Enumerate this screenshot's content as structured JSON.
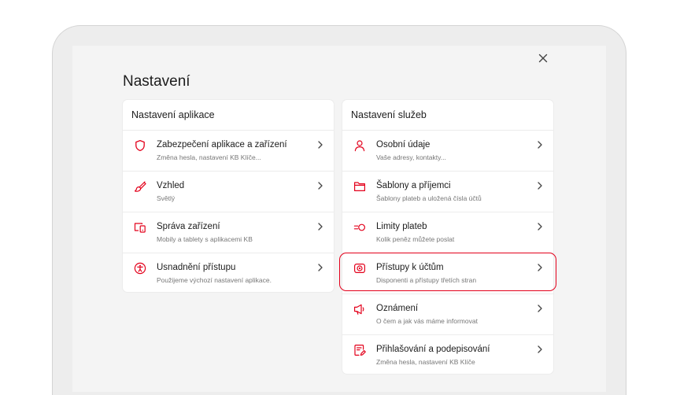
{
  "page": {
    "title": "Nastavení",
    "close_icon": "close-icon",
    "accent_color": "#e3001b"
  },
  "app_settings": {
    "header": "Nastavení aplikace",
    "items": [
      {
        "icon": "shield-icon",
        "title": "Zabezpečení aplikace a zařízení",
        "subtitle": "Změna hesla, nastavení KB Klíče..."
      },
      {
        "icon": "brush-icon",
        "title": "Vzhled",
        "subtitle": "Světlý"
      },
      {
        "icon": "devices-icon",
        "title": "Správa zařízení",
        "subtitle": "Mobily a tablety s aplikacemi KB"
      },
      {
        "icon": "accessibility-icon",
        "title": "Usnadnění přístupu",
        "subtitle": "Použijeme výchozí nastavení aplikace."
      }
    ]
  },
  "service_settings": {
    "header": "Nastavení služeb",
    "items": [
      {
        "icon": "user-icon",
        "title": "Osobní údaje",
        "subtitle": "Vaše adresy, kontakty..."
      },
      {
        "icon": "folder-icon",
        "title": "Šablony a příjemci",
        "subtitle": "Šablony plateb a uložená čísla účtů"
      },
      {
        "icon": "limits-icon",
        "title": "Limity plateb",
        "subtitle": "Kolik peněz můžete poslat"
      },
      {
        "icon": "account-access-icon",
        "title": "Přístupy k účtům",
        "subtitle": "Disponenti a přístupy třetích stran",
        "highlighted": true
      },
      {
        "icon": "megaphone-icon",
        "title": "Oznámení",
        "subtitle": "O čem a jak vás máme informovat"
      },
      {
        "icon": "sign-icon",
        "title": "Přihlašování a podepisování",
        "subtitle": "Změna hesla, nastavení KB Klíče"
      }
    ]
  }
}
